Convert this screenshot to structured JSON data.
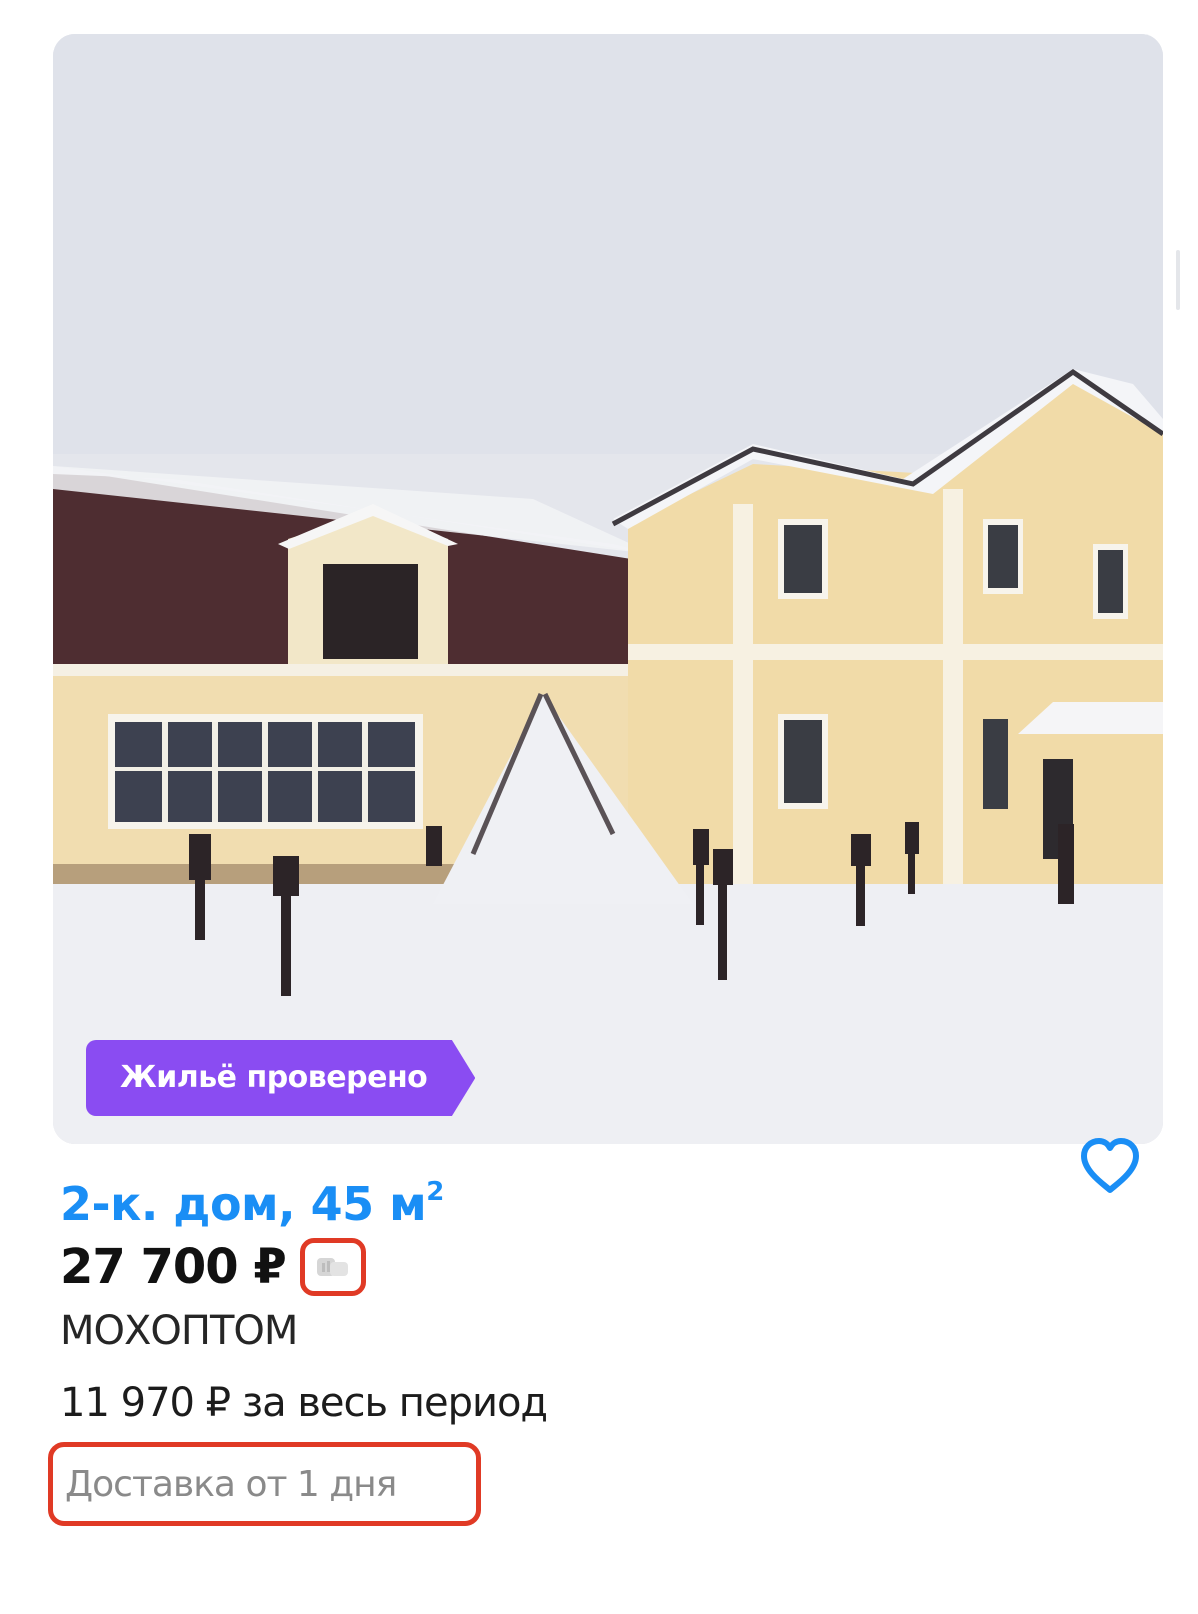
{
  "listing": {
    "badge": "Жильё проверено",
    "title": "2-к. дом, 45 м",
    "title_sup": "2",
    "price": "27 700 ₽",
    "seller": "МОХОПТОМ",
    "total_price": "11 970 ₽ за весь период",
    "delivery": "Доставка от 1 дня"
  },
  "colors": {
    "title": "#1a8ef5",
    "badge": "#8a4cf2",
    "highlight_outline": "#e03a25"
  },
  "icons": {
    "favorite": "heart-icon",
    "price_info": "price-history-icon"
  }
}
